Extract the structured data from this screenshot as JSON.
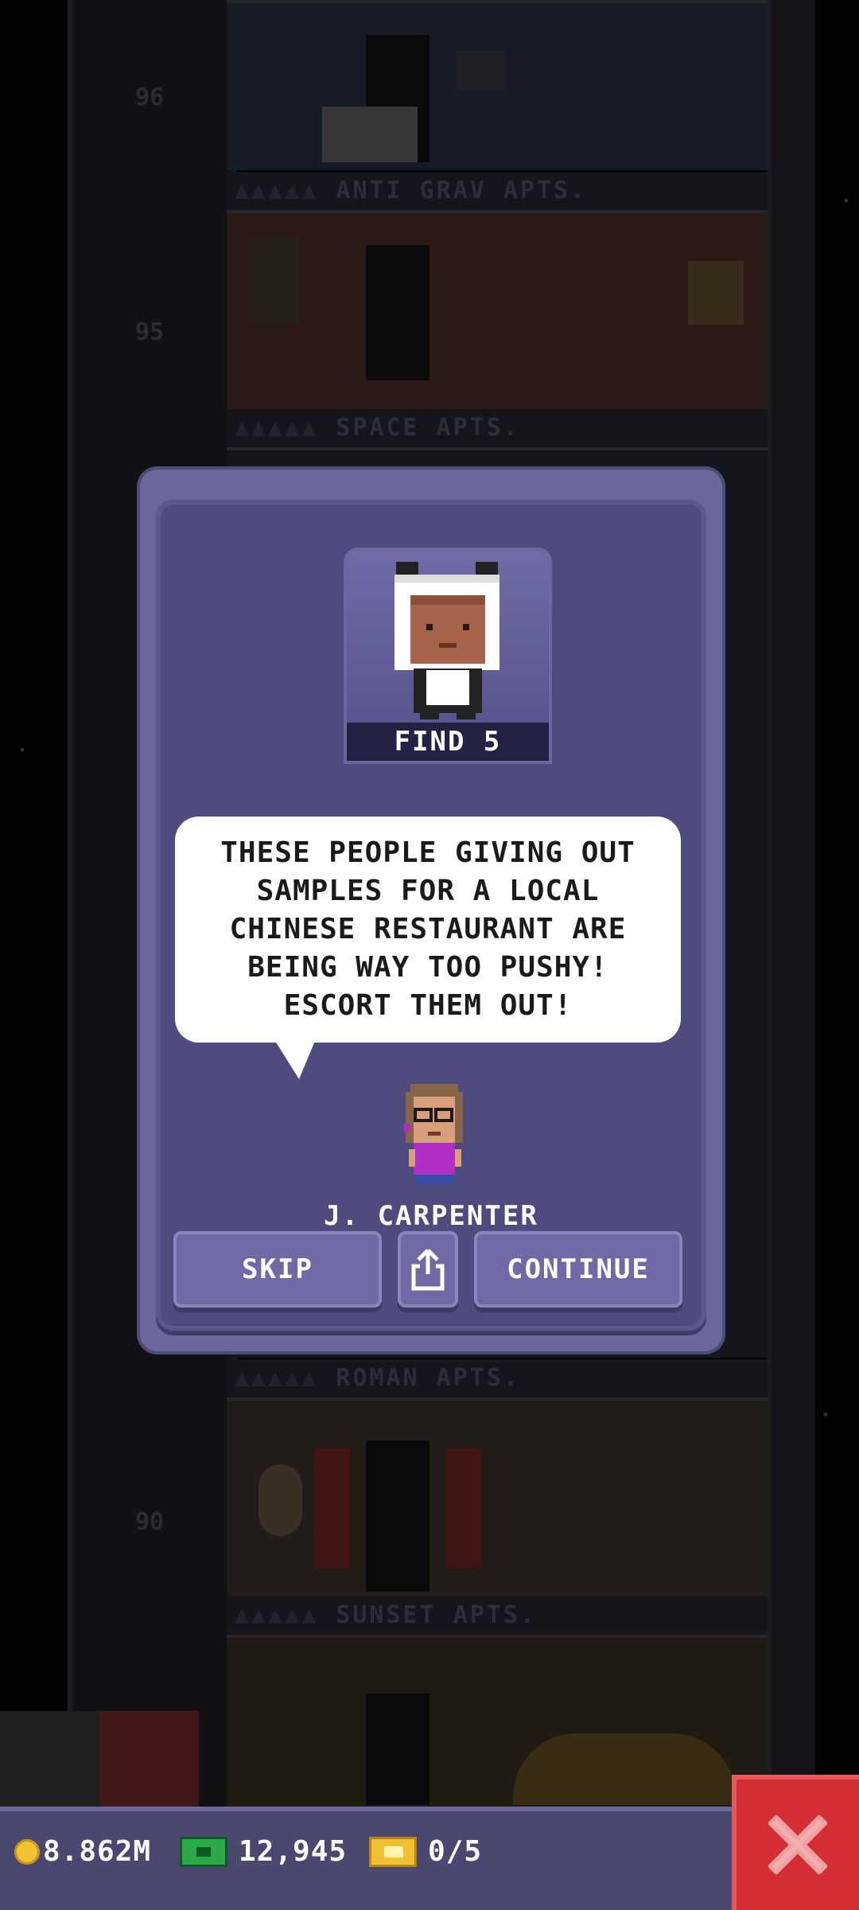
{
  "background": {
    "floor_labels": [
      "ANTI GRAV APTS.",
      "SPACE APTS.",
      "ROMAN APTS.",
      "SUNSET APTS."
    ],
    "floor_numbers": [
      "96",
      "95",
      "90"
    ]
  },
  "mission": {
    "portrait_caption": "FIND 5",
    "speech": "THESE PEOPLE GIVING OUT SAMPLES FOR A LOCAL CHINESE RESTAURANT ARE BEING WAY TOO PUSHY! ESCORT THEM OUT!",
    "npc_name": "J. CARPENTER",
    "skip_label": "SKIP",
    "continue_label": "CONTINUE",
    "share_icon": "share-icon"
  },
  "status_bar": {
    "coins": "8.862M",
    "bux": "12,945",
    "tickets": "0/5"
  },
  "colors": {
    "modal_frame": "#6a679d",
    "modal_inner": "#4e4b7e",
    "close_red": "#d42e34",
    "bar": "#4a4770"
  }
}
